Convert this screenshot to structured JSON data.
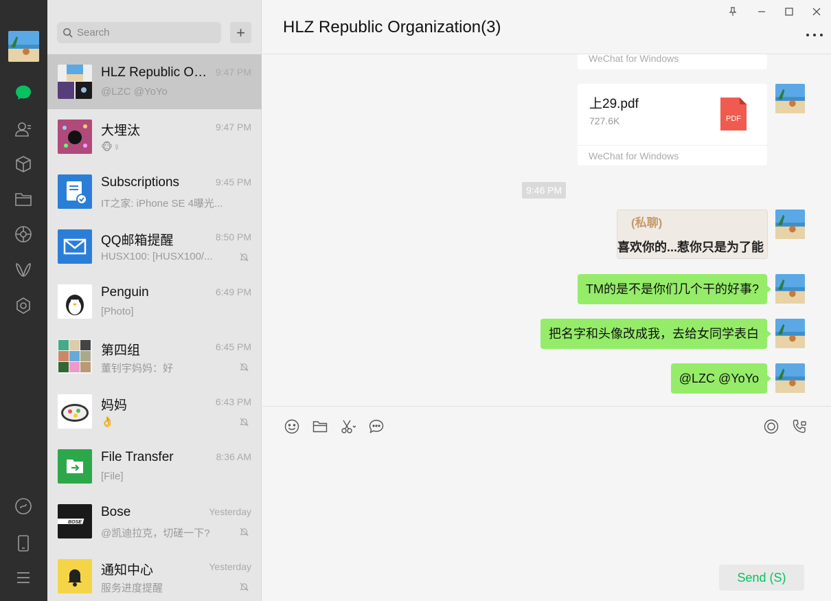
{
  "search": {
    "placeholder": "Search"
  },
  "chat": {
    "title": "HLZ Republic Organization(3)"
  },
  "conversations": [
    {
      "name": "HLZ Republic Organization(3)",
      "time": "9:47 PM",
      "preview": "@LZC @YoYo"
    },
    {
      "name": "大埋汰",
      "time": "9:47 PM",
      "preview": "🐵♀"
    },
    {
      "name": "Subscriptions",
      "time": "9:45 PM",
      "preview": "IT之家: iPhone SE 4曝光..."
    },
    {
      "name": "QQ邮箱提醒",
      "time": "8:50 PM",
      "preview": "HUSX100: [HUSX100/..."
    },
    {
      "name": "Penguin",
      "time": "6:49 PM",
      "preview": "[Photo]"
    },
    {
      "name": "第四组",
      "time": "6:45 PM",
      "preview": "董钊宇妈妈：好"
    },
    {
      "name": "妈妈",
      "time": "6:43 PM",
      "preview": "👌"
    },
    {
      "name": "File Transfer",
      "time": "8:36 AM",
      "preview": "[File]"
    },
    {
      "name": "Bose",
      "time": "Yesterday",
      "preview": "@凯迪拉克，切磋一下?"
    },
    {
      "name": "通知中心",
      "time": "Yesterday",
      "preview": "服务进度提醒"
    }
  ],
  "messages": {
    "prev_file_footer": "WeChat for Windows",
    "file": {
      "name": "上29.pdf",
      "size": "727.6K",
      "footer": "WeChat for Windows",
      "badge": "PDF"
    },
    "time_divider": "9:46 PM",
    "image_caption_top": "(私聊)",
    "image_caption_bottom": "喜欢你的...惹你只是为了能",
    "texts": [
      "TM的是不是你们几个干的好事?",
      "把名字和头像改成我，去给女同学表白",
      "@LZC @YoYo"
    ]
  },
  "composer": {
    "send_label": "Send (S)"
  },
  "colors": {
    "bubble": "#95ec69",
    "accent": "#07c160",
    "nav_bg": "#2e2e2e"
  },
  "icons": {
    "nav": [
      "chat-icon",
      "contacts-icon",
      "mini-programs-icon",
      "files-icon",
      "moments-icon",
      "search-feed-icon",
      "apps-icon",
      "miniprogram-bottom-icon",
      "phone-icon",
      "menu-icon"
    ],
    "toolbar": [
      "emoji-icon",
      "folder-icon",
      "scissors-icon",
      "chat-bubble-icon",
      "live-icon",
      "call-icon"
    ],
    "window": [
      "pin-icon",
      "minimize-icon",
      "maximize-icon",
      "close-icon"
    ]
  }
}
